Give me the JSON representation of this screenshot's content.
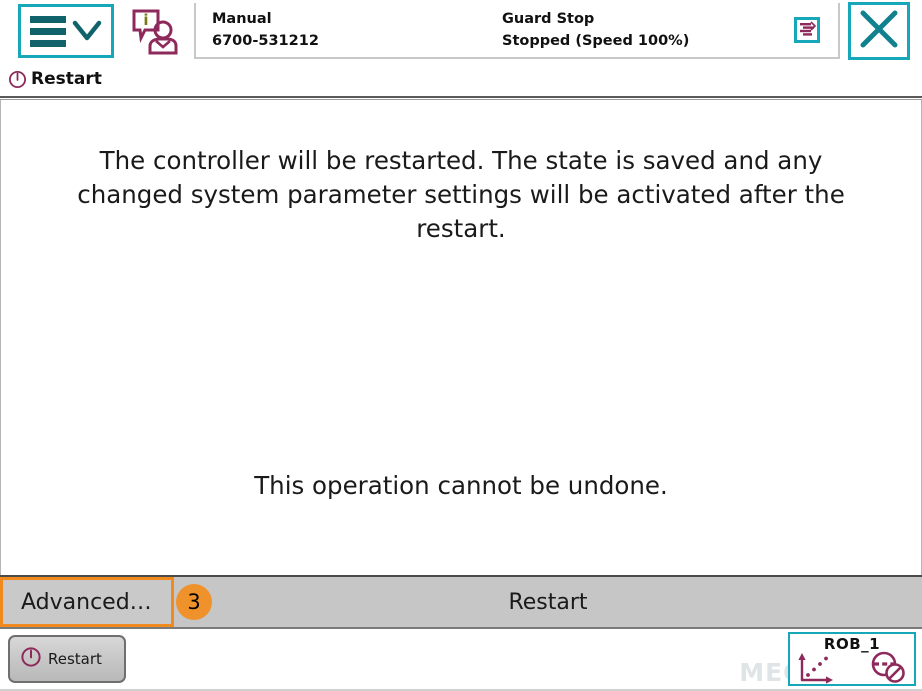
{
  "header": {
    "menu_button": {
      "icon": "hamburger-icon",
      "chevron": "chevron-down-icon"
    },
    "operator_icon": "operator-info-icon",
    "status": {
      "mode_label": "Manual",
      "controller_name": "6700-531212",
      "state_label": "Guard Stop",
      "state_detail": "Stopped (Speed 100%)"
    },
    "task_icon": "program-task-icon",
    "close_label": "close-icon"
  },
  "window": {
    "title": "Restart",
    "title_icon": "power-restart-icon"
  },
  "main": {
    "message_primary": "The controller will be restarted. The state is saved and any changed system parameter settings will be activated after the restart.",
    "message_secondary": "This operation cannot be undone."
  },
  "action_bar": {
    "advanced_label": "Advanced…",
    "badge": "3",
    "restart_label": "Restart"
  },
  "taskbar": {
    "task_label": "Restart",
    "task_icon": "power-restart-icon",
    "jog": {
      "robot_name": "ROB_1",
      "axes_icon": "jog-axes-icon",
      "no_motion_icon": "no-motion-supervision-icon"
    }
  },
  "watermark": {
    "text": "MECH MIND"
  },
  "colors": {
    "teal_accent": "#16a8b8",
    "teal_dark": "#11636b",
    "magenta": "#8e2a5b",
    "orange_highlight": "#f08a1e",
    "badge_orange": "#f0922b",
    "action_bar_gray": "#c6c6c6"
  }
}
